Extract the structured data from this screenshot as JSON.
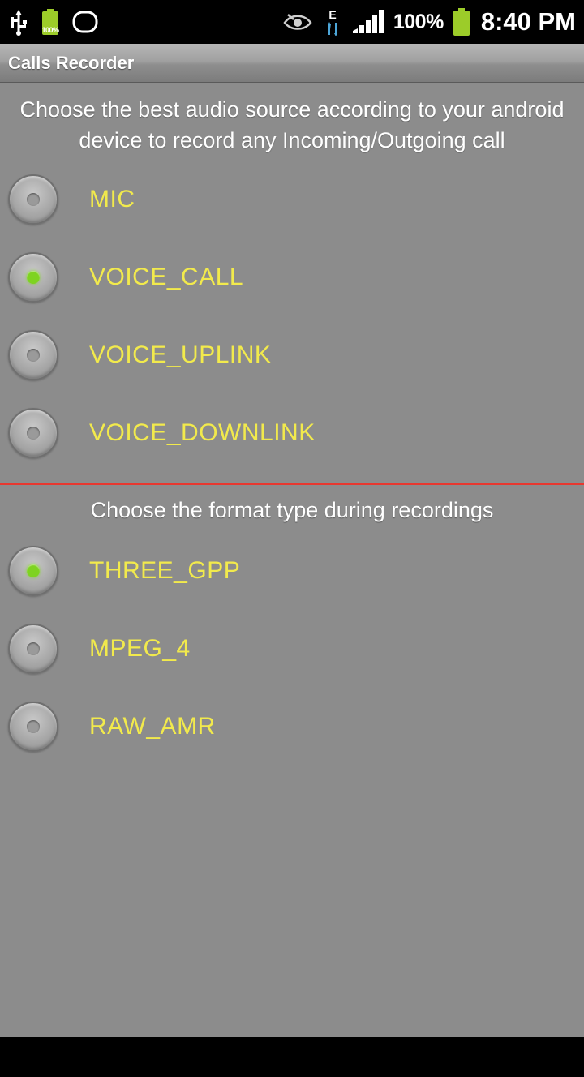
{
  "status_bar": {
    "icons_left": [
      "usb-icon",
      "battery-charging-icon",
      "rounded-square-icon"
    ],
    "battery_small_pct": "100%",
    "icons_right": [
      "eye-icon",
      "edge-network-icon",
      "signal-icon"
    ],
    "battery_pct": "100%",
    "clock": "8:40 PM"
  },
  "action_bar": {
    "title": "Calls Recorder"
  },
  "audio_source": {
    "header": "Choose the best audio source according to your android device to record any Incoming/Outgoing call",
    "options": [
      {
        "label": "MIC",
        "checked": false
      },
      {
        "label": "VOICE_CALL",
        "checked": true
      },
      {
        "label": "VOICE_UPLINK",
        "checked": false
      },
      {
        "label": "VOICE_DOWNLINK",
        "checked": false
      }
    ]
  },
  "format_type": {
    "header": "Choose the format type during recordings",
    "options": [
      {
        "label": "THREE_GPP",
        "checked": true
      },
      {
        "label": "MPEG_4",
        "checked": false
      },
      {
        "label": "RAW_AMR",
        "checked": false
      }
    ]
  },
  "colors": {
    "accent_divider": "#e8382f",
    "label_yellow": "#f2ea4c",
    "radio_on": "#7ed321",
    "background": "#8c8c8c"
  }
}
